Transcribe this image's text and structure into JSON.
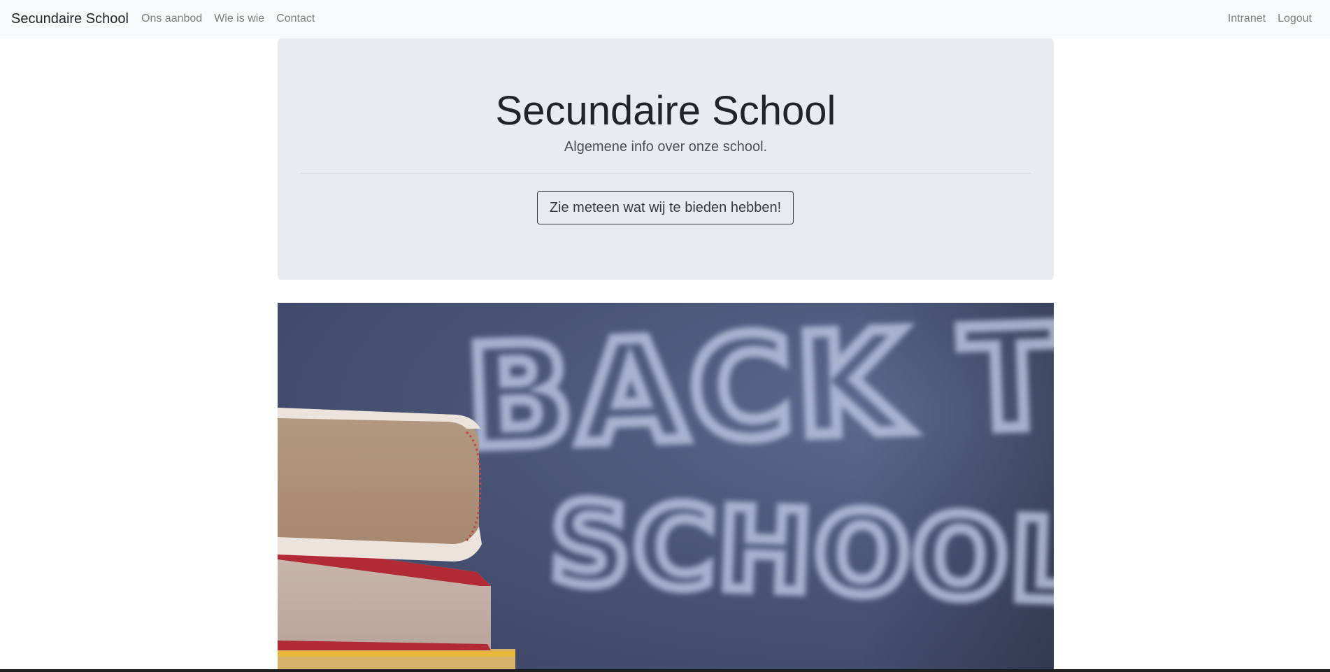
{
  "navbar": {
    "brand": "Secundaire School",
    "left_links": [
      "Ons aanbod",
      "Wie is wie",
      "Contact"
    ],
    "right_links": [
      "Intranet",
      "Logout"
    ]
  },
  "jumbotron": {
    "title": "Secundaire School",
    "lead": "Algemene info over onze school.",
    "button_label": "Zie meteen wat wij te bieden hebben!"
  },
  "hero_image": {
    "chalk_text_line1": "BACK TO",
    "chalk_text_line2": "SCHOOL",
    "description": "books-on-chalkboard-photo"
  },
  "colors": {
    "navbar_bg": "#f8f9fa",
    "jumbotron_bg": "#e9ecef",
    "chalkboard": "#4a5577",
    "chalk": "#b8c2de"
  }
}
